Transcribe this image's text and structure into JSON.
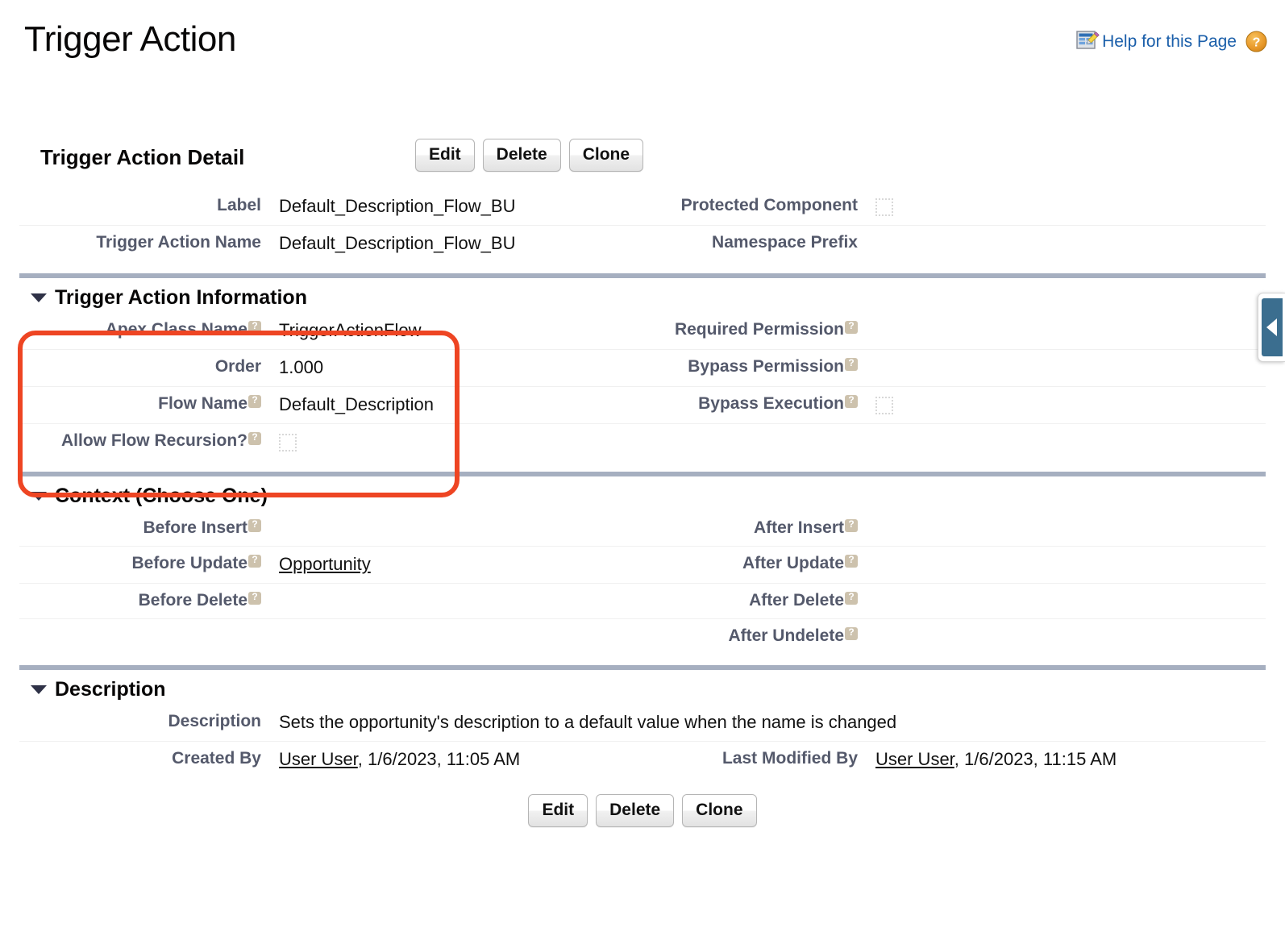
{
  "page": {
    "title": "Trigger Action",
    "help_link": "Help for this Page",
    "help_grid_icon": "edit-grid-icon",
    "help_question_icon": "question-mark-icon"
  },
  "detail": {
    "title": "Trigger Action Detail",
    "buttons": {
      "edit": "Edit",
      "delete": "Delete",
      "clone": "Clone"
    }
  },
  "top_fields": {
    "label": {
      "label": "Label",
      "value": "Default_Description_Flow_BU"
    },
    "trigger_action_name": {
      "label": "Trigger Action Name",
      "value": "Default_Description_Flow_BU"
    },
    "protected_component": {
      "label": "Protected Component",
      "value": "",
      "checkbox": "unchecked"
    },
    "namespace_prefix": {
      "label": "Namespace Prefix",
      "value": ""
    }
  },
  "sections": {
    "trigger_action_information": {
      "title": "Trigger Action Information",
      "collapse_icon": "triangle-down-icon",
      "left_fields": [
        {
          "label": "Apex Class Name",
          "has_help": true,
          "value": "TriggerActionFlow",
          "type": "text"
        },
        {
          "label": "Order",
          "has_help": false,
          "value": "1.000",
          "type": "text"
        },
        {
          "label": "Flow Name",
          "has_help": true,
          "value": "Default_Description",
          "type": "text"
        },
        {
          "label": "Allow Flow Recursion?",
          "has_help": true,
          "value": "",
          "type": "checkbox",
          "checkbox": "unchecked"
        }
      ],
      "right_fields": [
        {
          "label": "Required Permission",
          "has_help": true,
          "value": "",
          "type": "text"
        },
        {
          "label": "Bypass Permission",
          "has_help": true,
          "value": "",
          "type": "text"
        },
        {
          "label": "Bypass Execution",
          "has_help": true,
          "value": "",
          "type": "checkbox",
          "checkbox": "unchecked"
        }
      ]
    },
    "context": {
      "title": "Context (Choose One)",
      "collapse_icon": "triangle-down-icon",
      "left_fields": [
        {
          "label": "Before Insert",
          "has_help": true,
          "value": "",
          "is_link": false
        },
        {
          "label": "Before Update",
          "has_help": true,
          "value": "Opportunity",
          "is_link": true
        },
        {
          "label": "Before Delete",
          "has_help": true,
          "value": "",
          "is_link": false
        }
      ],
      "right_fields": [
        {
          "label": "After Insert",
          "has_help": true,
          "value": ""
        },
        {
          "label": "After Update",
          "has_help": true,
          "value": ""
        },
        {
          "label": "After Delete",
          "has_help": true,
          "value": ""
        },
        {
          "label": "After Undelete",
          "has_help": true,
          "value": ""
        }
      ]
    },
    "description": {
      "title": "Description",
      "collapse_icon": "triangle-down-icon",
      "description": {
        "label": "Description",
        "value": "Sets the opportunity's description to a default value when the name is changed"
      },
      "created_by": {
        "label": "Created By",
        "user": "User User",
        "timestamp": ", 1/6/2023, 11:05 AM"
      },
      "last_modified_by": {
        "label": "Last Modified By",
        "user": "User User",
        "timestamp": ", 1/6/2023, 11:15 AM"
      }
    }
  },
  "annotation": {
    "name": "red-highlight-box",
    "color": "#ee4523"
  },
  "sidebar_toggle": {
    "name": "sidebar-collapse-toggle",
    "icon": "triangle-left-icon",
    "color": "#3b6e8f"
  }
}
